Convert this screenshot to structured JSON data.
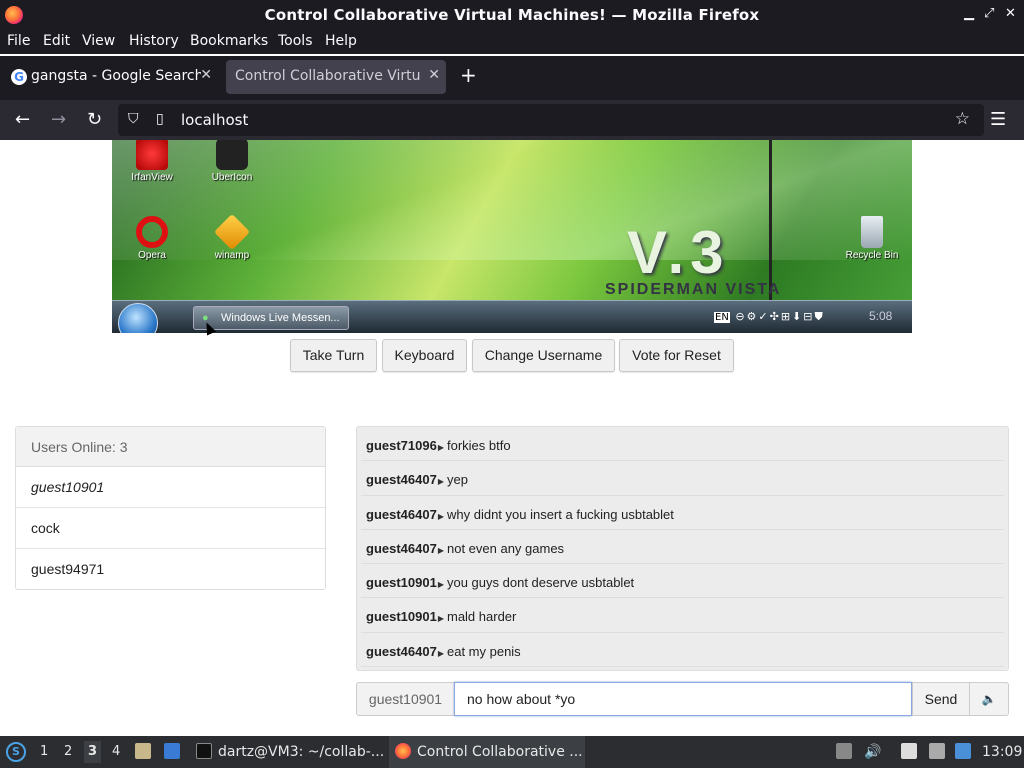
{
  "window": {
    "title": "Control Collaborative Virtual Machines! — Mozilla Firefox"
  },
  "menu": [
    "File",
    "Edit",
    "View",
    "History",
    "Bookmarks",
    "Tools",
    "Help"
  ],
  "tabs": [
    {
      "label": "gangsta - Google Search",
      "active": false
    },
    {
      "label": "Control Collaborative Virtual Machines!",
      "active": true
    }
  ],
  "address": {
    "url": "localhost"
  },
  "vm": {
    "desktop_icons": [
      "IrfanView",
      "UberIcon",
      "Opera",
      "winamp",
      "Recycle Bin"
    ],
    "wallpaper_text": "V.3",
    "wallpaper_subtext": "SPIDERMAN VISTA",
    "taskbar_button": "Windows Live Messen...",
    "tray_lang": "EN",
    "clock": "5:08"
  },
  "controls": {
    "take_turn": "Take Turn",
    "keyboard": "Keyboard",
    "change_username": "Change Username",
    "vote_reset": "Vote for Reset"
  },
  "users": {
    "header": "Users Online: 3",
    "list": [
      "guest10901",
      "cock",
      "guest94971"
    ],
    "self": "guest10901"
  },
  "chat": {
    "messages": [
      {
        "user": "guest71096",
        "text": "forkies btfo"
      },
      {
        "user": "guest46407",
        "text": "yep"
      },
      {
        "user": "guest46407",
        "text": "why didnt you insert a fucking usbtablet"
      },
      {
        "user": "guest46407",
        "text": "not even any games"
      },
      {
        "user": "guest10901",
        "text": "you guys dont deserve usbtablet"
      },
      {
        "user": "guest10901",
        "text": "mald harder"
      },
      {
        "user": "guest46407",
        "text": "eat my penis"
      }
    ]
  },
  "input": {
    "username": "guest10901",
    "value": "no how about *yo",
    "send": "Send"
  },
  "os_taskbar": {
    "workspaces": [
      "1",
      "2",
      "3",
      "4"
    ],
    "current_workspace": "3",
    "apps": [
      "dartz@VM3: ~/collab-...",
      "Control Collaborative ..."
    ],
    "clock": "13:09"
  },
  "colors": {
    "firefox_dark": "#1c1b22",
    "firefox_nav": "#2b2a33",
    "active_tab": "#42414d",
    "taskbar": "#2b2d31",
    "input_focus": "#8aa8e0"
  }
}
